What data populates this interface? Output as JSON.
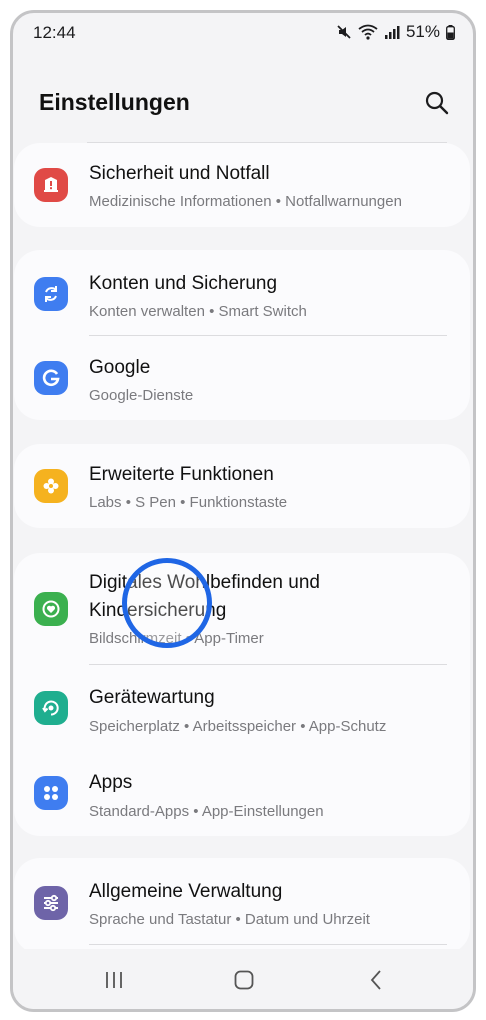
{
  "status_bar": {
    "time": "12:44",
    "battery": "51%"
  },
  "header": {
    "title": "Einstellungen"
  },
  "groups": [
    {
      "items": [
        {
          "title": "Sicherheit und Notfall",
          "subtitle": "Medizinische Informationen  •  Notfallwarnungen",
          "icon": "safety-emergency-icon",
          "color": "#e04a46"
        }
      ]
    },
    {
      "items": [
        {
          "title": "Konten und Sicherung",
          "subtitle": "Konten verwalten  •  Smart Switch",
          "icon": "sync-arrows-icon",
          "color": "#3f7df0"
        },
        {
          "title": "Google",
          "subtitle": "Google-Dienste",
          "icon": "google-g-icon",
          "color": "#3f7df0"
        }
      ]
    },
    {
      "items": [
        {
          "title": "Erweiterte Funktionen",
          "subtitle": "Labs  •  S Pen  •  Funktionstaste",
          "icon": "flower-gear-icon",
          "color": "#f5b21f"
        }
      ]
    },
    {
      "items": [
        {
          "title": "Digitales Wohlbefinden und",
          "title2": "Kindersicherung",
          "subtitle": "Bildschirmzeit  •  App-Timer",
          "icon": "heart-ring-icon",
          "color": "#3bb04f"
        },
        {
          "title": "Gerätewartung",
          "subtitle": "Speicherplatz  •  Arbeitsspeicher  •  App-Schutz",
          "icon": "device-care-icon",
          "color": "#1fae8f"
        },
        {
          "title": "Apps",
          "subtitle": "Standard-Apps  •  App-Einstellungen",
          "icon": "apps-grid-icon",
          "color": "#3f7df0"
        }
      ]
    },
    {
      "items": [
        {
          "title": "Allgemeine Verwaltung",
          "subtitle": "Sprache und Tastatur  •  Datum und Uhrzeit",
          "icon": "sliders-icon",
          "color": "#6e64a8"
        }
      ]
    }
  ]
}
